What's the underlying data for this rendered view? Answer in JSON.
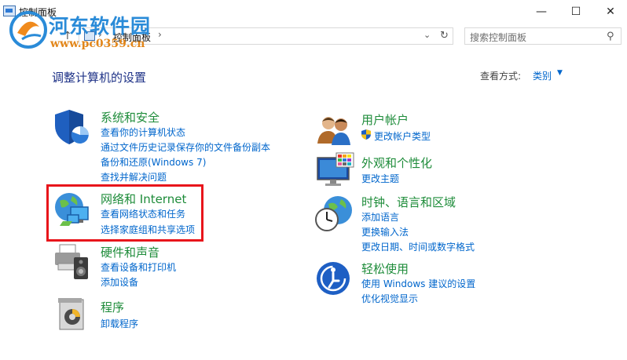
{
  "window": {
    "title": "控制面板",
    "minimize": "—",
    "maximize": "☐",
    "close": "✕"
  },
  "watermark": {
    "name": "河东软件园",
    "url": "www.pc0359.cn"
  },
  "nav": {
    "address": "控制面板",
    "separator": "›",
    "search_placeholder": "搜索控制面板"
  },
  "main": {
    "heading": "调整计算机的设置",
    "view_by_label": "查看方式:",
    "view_by_value": "类别"
  },
  "categories": [
    {
      "title": "系统和安全",
      "links": [
        "查看你的计算机状态",
        "通过文件历史记录保存你的文件备份副本",
        "备份和还原(Windows 7)",
        "查找并解决问题"
      ]
    },
    {
      "title": "网络和 Internet",
      "links": [
        "查看网络状态和任务",
        "选择家庭组和共享选项"
      ]
    },
    {
      "title": "硬件和声音",
      "links": [
        "查看设备和打印机",
        "添加设备"
      ]
    },
    {
      "title": "程序",
      "links": [
        "卸载程序"
      ]
    },
    {
      "title": "用户帐户",
      "links": [
        "更改帐户类型"
      ]
    },
    {
      "title": "外观和个性化",
      "links": [
        "更改主题"
      ]
    },
    {
      "title": "时钟、语言和区域",
      "links": [
        "添加语言",
        "更换输入法",
        "更改日期、时间或数字格式"
      ]
    },
    {
      "title": "轻松使用",
      "links": [
        "使用 Windows 建议的设置",
        "优化视觉显示"
      ]
    }
  ],
  "colors": {
    "category_title": "#1e8c3a",
    "link": "#0066cc",
    "heading": "#1e3287",
    "highlight_box": "#e8151b"
  }
}
